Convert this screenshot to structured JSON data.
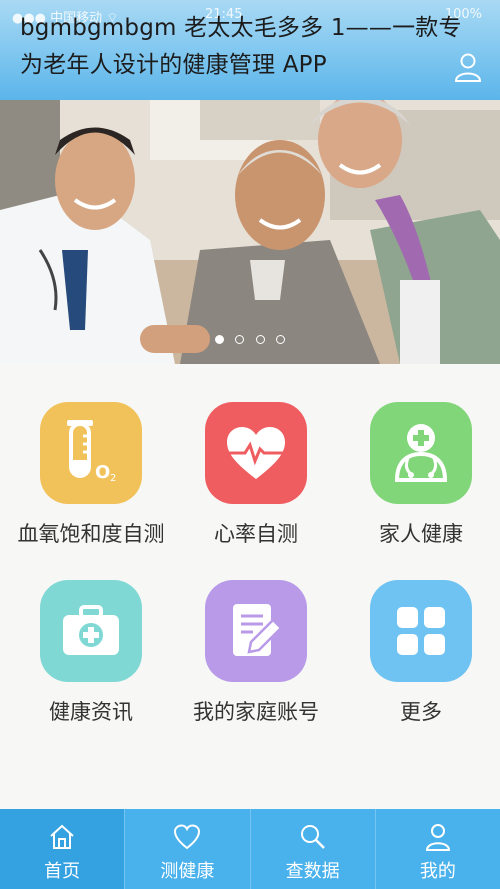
{
  "header": {
    "status_left": "●●● 中国移动 ⌔",
    "status_center": "21:45",
    "status_right": "100%",
    "title_line1": "bgmbgmbgm 老太太毛多多 1——一款专",
    "title_line2": "为老年人设计的健康管理 APP",
    "user_icon": "user-icon"
  },
  "banner": {
    "slides": 4,
    "active_slide": 1
  },
  "grid": {
    "items": [
      {
        "label": "血氧饱和度自测",
        "icon": "test-tube-icon",
        "color": "#f2c25a"
      },
      {
        "label": "心率自测",
        "icon": "heart-rate-icon",
        "color": "#ef5d60"
      },
      {
        "label": "家人健康",
        "icon": "family-doctor-icon",
        "color": "#82d67a"
      },
      {
        "label": "健康资讯",
        "icon": "medical-kit-icon",
        "color": "#7fd8d4"
      },
      {
        "label": "我的家庭账号",
        "icon": "edit-note-icon",
        "color": "#b89ae8"
      },
      {
        "label": "更多",
        "icon": "grid-icon",
        "color": "#6fc3f2"
      }
    ]
  },
  "tabbar": {
    "tabs": [
      {
        "label": "首页",
        "icon": "home-icon",
        "active": true
      },
      {
        "label": "测健康",
        "icon": "heart-icon",
        "active": false
      },
      {
        "label": "查数据",
        "icon": "search-icon",
        "active": false
      },
      {
        "label": "我的",
        "icon": "user-icon",
        "active": false
      }
    ],
    "color": "#49b1ec",
    "active_color": "#34a1e1"
  }
}
